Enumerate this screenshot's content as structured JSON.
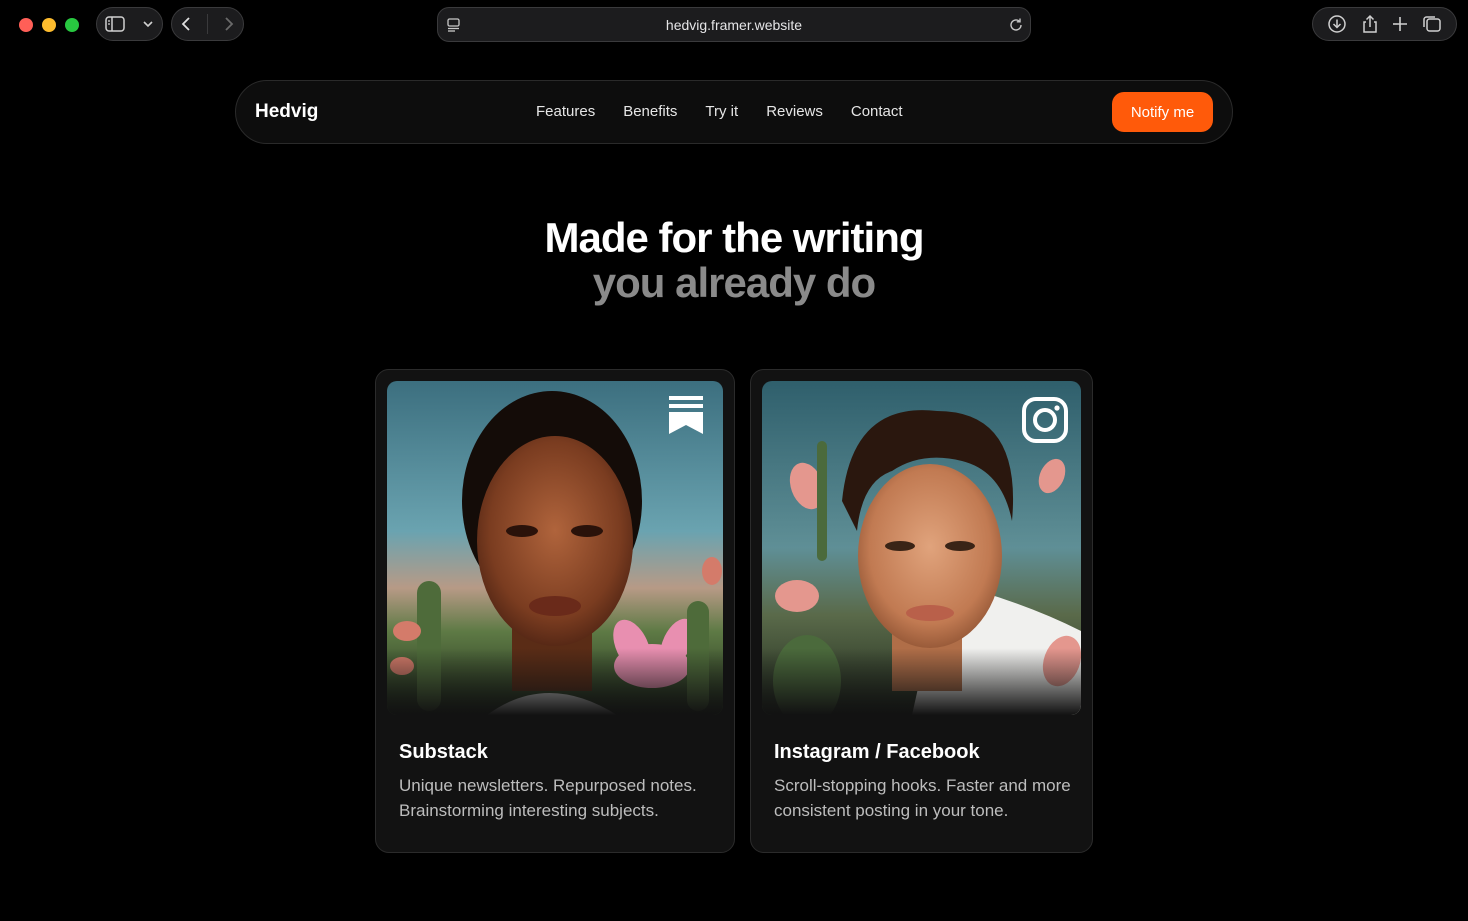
{
  "browser": {
    "url": "hedvig.framer.website"
  },
  "nav": {
    "brand": "Hedvig",
    "links": [
      "Features",
      "Benefits",
      "Try it",
      "Reviews",
      "Contact"
    ],
    "cta": "Notify me"
  },
  "hero": {
    "line1": "Made for the writing",
    "line2": "you already do"
  },
  "cards": [
    {
      "title": "Substack",
      "description": "Unique newsletters. Repurposed notes. Brainstorming interesting subjects.",
      "icon": "substack-icon"
    },
    {
      "title": "Instagram / Facebook",
      "description": "Scroll-stopping hooks. Faster and more consistent posting in your tone.",
      "icon": "instagram-icon"
    }
  ],
  "colors": {
    "accent": "#ff5a0a",
    "background": "#000000",
    "card": "#121212",
    "muted_text": "#8a8a8a"
  }
}
